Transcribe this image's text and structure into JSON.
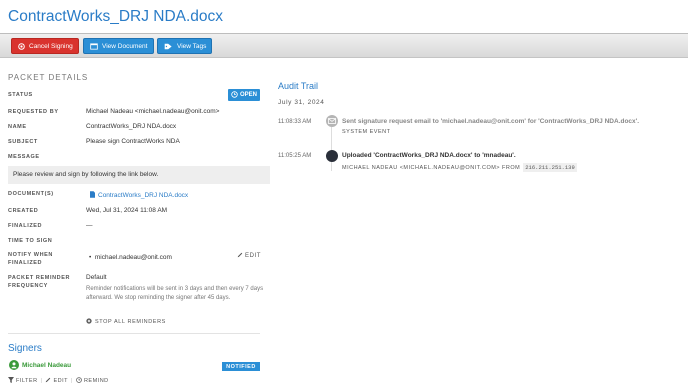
{
  "page": {
    "title": "ContractWorks_DRJ NDA.docx"
  },
  "toolbar": {
    "cancel_label": "Cancel Signing",
    "view_document_label": "View Document",
    "view_tags_label": "View Tags"
  },
  "packet": {
    "heading": "PACKET DETAILS",
    "status_label": "STATUS",
    "status_value": "OPEN",
    "requested_by_label": "REQUESTED BY",
    "requested_by_value": "Michael Nadeau <michael.nadeau@onit.com>",
    "name_label": "NAME",
    "name_value": "ContractWorks_DRJ NDA.docx",
    "subject_label": "SUBJECT",
    "subject_value": "Please sign ContractWorks NDA",
    "message_label": "MESSAGE",
    "message_value": "Please review and sign by following the link below.",
    "documents_label": "DOCUMENT(S)",
    "document_link": "ContractWorks_DRJ NDA.docx",
    "created_label": "CREATED",
    "created_value": "Wed, Jul 31, 2024 11:08 AM",
    "finalized_label": "FINALIZED",
    "finalized_value": "—",
    "time_to_sign_label": "TIME TO SIGN",
    "notify_label_line1": "NOTIFY WHEN",
    "notify_label_line2": "FINALIZED",
    "notify_value": "michael.nadeau@onit.com",
    "edit_label": "EDIT",
    "reminder_label_line1": "PACKET REMINDER",
    "reminder_label_line2": "FREQUENCY",
    "reminder_value": "Default",
    "reminder_note": "Reminder notifications will be sent in 3 days and then every 7 days afterward. We stop reminding the signer after 45 days.",
    "stop_reminders_label": "STOP ALL REMINDERS"
  },
  "signers": {
    "heading": "Signers",
    "items": [
      {
        "name": "Michael Nadeau",
        "status": "NOTIFIED"
      }
    ],
    "filter_label": "FILTER",
    "edit_label": "EDIT",
    "remind_label": "REMIND"
  },
  "audit": {
    "heading": "Audit Trail",
    "date": "July 31, 2024",
    "events": [
      {
        "time": "11:08:33 AM",
        "title": "Sent signature request email to 'michael.nadeau@onit.com' for 'ContractWorks_DRJ NDA.docx'.",
        "sub": "SYSTEM EVENT"
      },
      {
        "time": "11:05:25 AM",
        "title": "Uploaded 'ContractWorks_DRJ NDA.docx' to 'mnadeau'.",
        "sub": "MICHAEL NADEAU <MICHAEL.NADEAU@ONIT.COM> FROM",
        "ip": "216.211.251.139"
      }
    ]
  },
  "colors": {
    "accent": "#2a7cc7",
    "danger": "#d9332e",
    "button_blue": "#2b8fd6",
    "signer_green": "#3a9a3a"
  }
}
